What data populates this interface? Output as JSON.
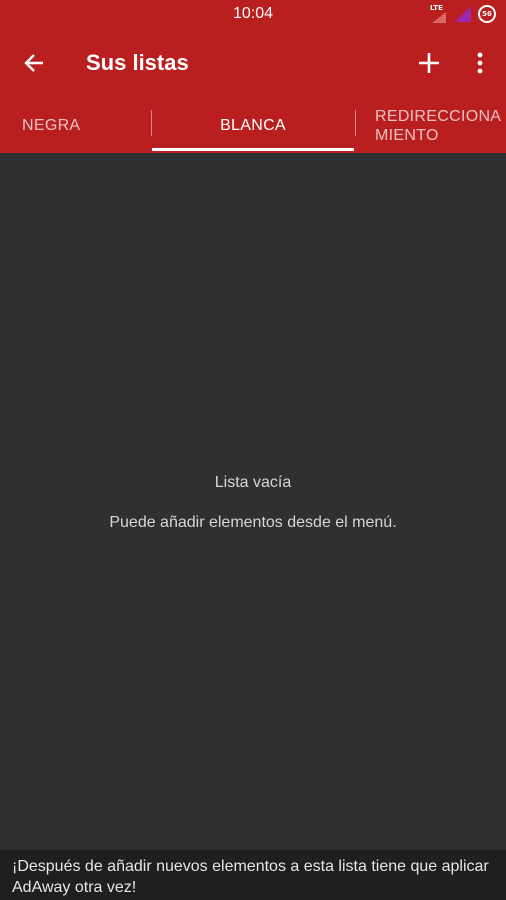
{
  "status_bar": {
    "time": "10:04",
    "network_label": "LTE",
    "battery_level": "56"
  },
  "app_bar": {
    "title": "Sus listas",
    "icons": [
      "back-arrow-icon",
      "add-icon",
      "more-vert-icon"
    ]
  },
  "tabs": [
    {
      "label": "NEGRA",
      "active": false
    },
    {
      "label": "BLANCA",
      "active": true
    },
    {
      "label": "REDIRECCIONAMIENTO",
      "active": false
    }
  ],
  "empty_state": {
    "title": "Lista vacía",
    "subtitle": "Puede añadir elementos desde el menú."
  },
  "notice": {
    "text": "¡Después de añadir nuevos elementos a esta lista tiene que aplicar AdAway otra vez!"
  },
  "colors": {
    "primary": "#ba1f1f",
    "background": "#303030",
    "notice_background": "#1f1f1f",
    "signal_accent": "#9c27b0"
  }
}
